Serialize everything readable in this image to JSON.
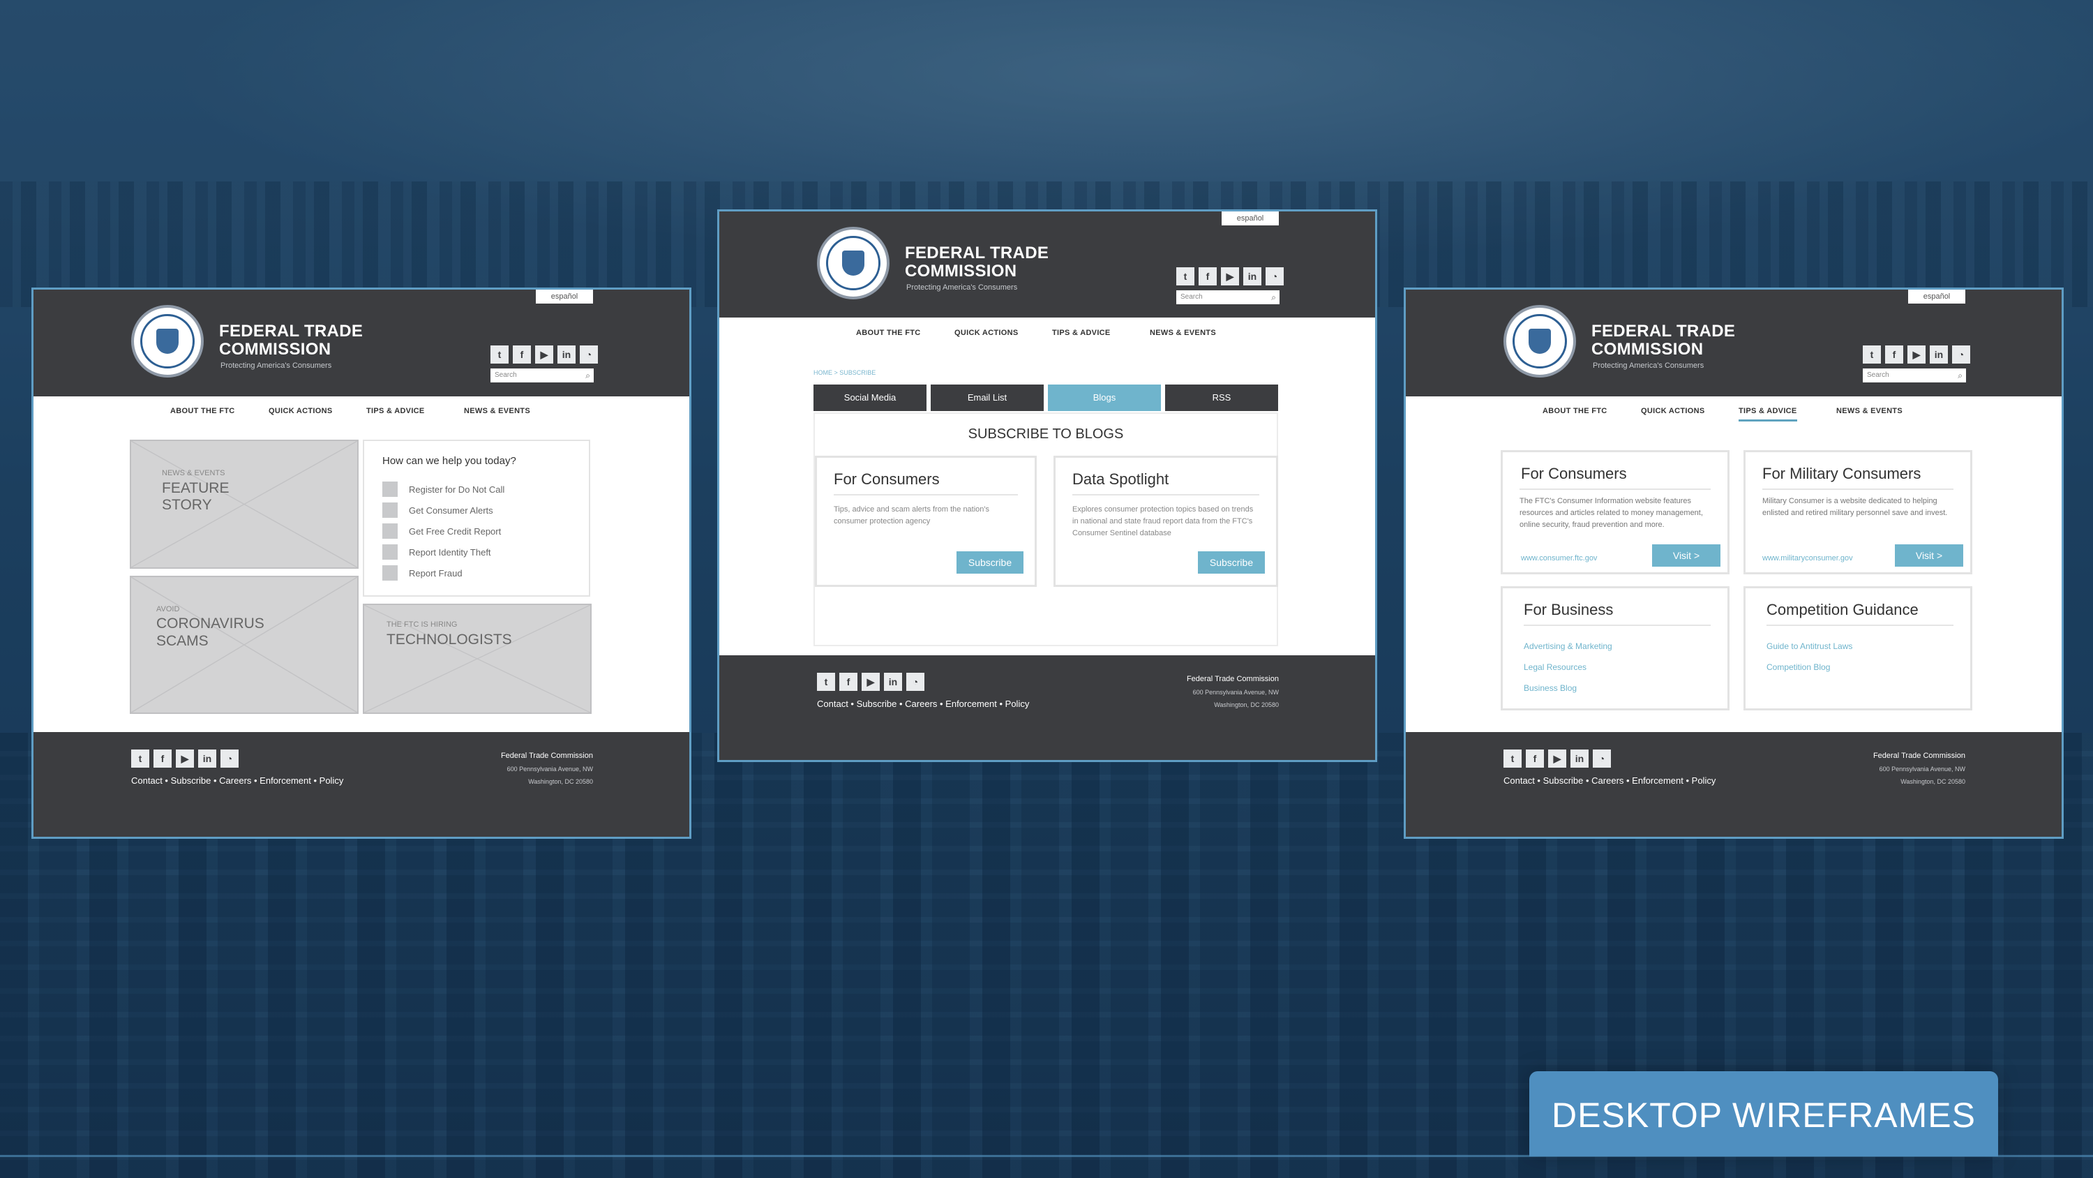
{
  "brand": {
    "line1": "FEDERAL TRADE",
    "line2": "COMMISSION",
    "tagline": "Protecting America's Consumers",
    "espanol": "español",
    "search_placeholder": "Search"
  },
  "social_icons": [
    "twitter-icon",
    "facebook-icon",
    "youtube-icon",
    "linkedin-icon",
    "rss-icon"
  ],
  "nav": [
    "ABOUT THE FTC",
    "QUICK ACTIONS",
    "TIPS & ADVICE",
    "NEWS & EVENTS"
  ],
  "footer": {
    "links": "Contact • Subscribe • Careers • Enforcement • Policy",
    "org": "Federal Trade Commission",
    "address_line1": "600 Pennsylvania Avenue, NW",
    "address_line2": "Washington, DC 20580"
  },
  "home": {
    "feature_kicker": "NEWS & EVENTS",
    "feature_title_1": "FEATURE",
    "feature_title_2": "STORY",
    "scams_kicker": "AVOID",
    "scams_title_1": "CORONAVIRUS",
    "scams_title_2": "SCAMS",
    "tech_kicker": "THE FTC IS HIRING",
    "tech_title": "TECHNOLOGISTS",
    "help_question": "How can we help you today?",
    "help_items": [
      "Register for Do Not Call",
      "Get Consumer Alerts",
      "Get Free Credit Report",
      "Report Identity Theft",
      "Report Fraud"
    ]
  },
  "subscribe": {
    "breadcrumb": "HOME > SUBSCRIBE",
    "tabs": [
      "Social Media",
      "Email List",
      "Blogs",
      "RSS"
    ],
    "active_tab": "Blogs",
    "title": "SUBSCRIBE TO BLOGS",
    "cards": [
      {
        "title": "For Consumers",
        "desc": "Tips, advice and scam alerts from the nation's consumer protection agency",
        "button": "Subscribe"
      },
      {
        "title": "Data Spotlight",
        "desc": "Explores consumer protection topics based on trends in national and state fraud report data from the FTC's Consumer Sentinel database",
        "button": "Subscribe"
      }
    ]
  },
  "tips": {
    "consumers": {
      "title": "For Consumers",
      "desc": "The FTC's Consumer Information website features resources and articles related to money management, online security, fraud prevention and more.",
      "link": "www.consumer.ftc.gov",
      "button": "Visit >"
    },
    "military": {
      "title": "For Military Consumers",
      "desc": "Military Consumer is a website dedicated to helping enlisted and retired military personnel save and invest.",
      "link": "www.militaryconsumer.gov",
      "button": "Visit >"
    },
    "business": {
      "title": "For Business",
      "links": [
        "Advertising & Marketing",
        "Legal Resources",
        "Business Blog"
      ]
    },
    "competition": {
      "title": "Competition Guidance",
      "links": [
        "Guide to Antitrust Laws",
        "Competition Blog"
      ]
    }
  },
  "banner": "DESKTOP WIREFRAMES",
  "colors": {
    "header": "#3c3d40",
    "accent": "#6fb4cc",
    "frame_border": "#5f9dc4",
    "banner": "#4f8fc0"
  }
}
